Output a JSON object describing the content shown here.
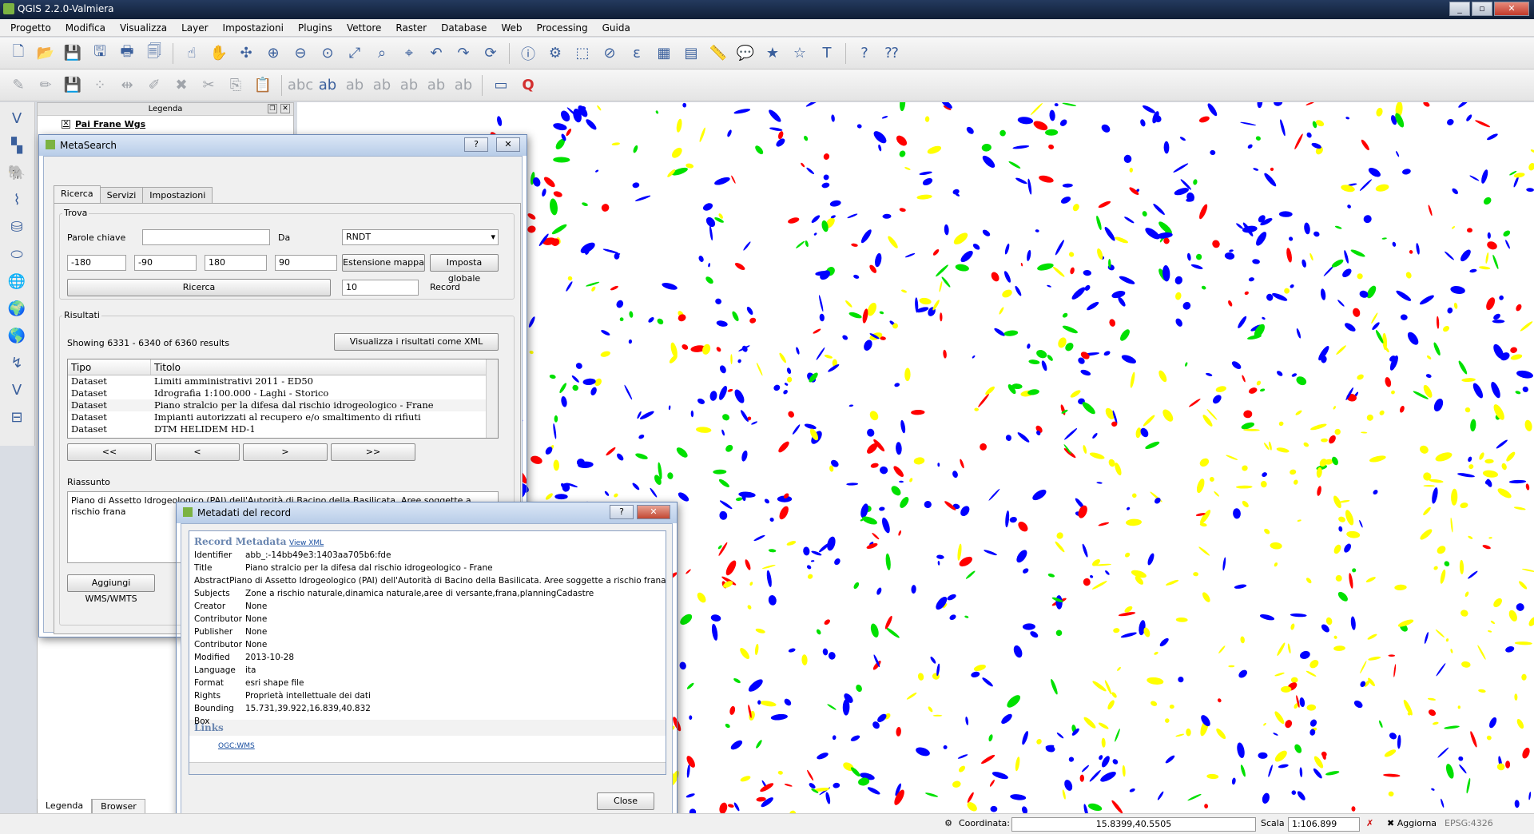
{
  "window": {
    "title": "QGIS 2.2.0-Valmiera",
    "buttons": [
      "_",
      "▫",
      "✕"
    ]
  },
  "menu": [
    "Progetto",
    "Modifica",
    "Visualizza",
    "Layer",
    "Impostazioni",
    "Plugins",
    "Vettore",
    "Raster",
    "Database",
    "Web",
    "Processing",
    "Guida"
  ],
  "legend": {
    "header": "Legenda",
    "layer_name": "Pai Frane Wgs",
    "tabs": [
      "Legenda",
      "Browser"
    ]
  },
  "metasearch": {
    "title": "MetaSearch",
    "tabs": [
      "Ricerca",
      "Servizi",
      "Impostazioni"
    ],
    "find_group": "Trova",
    "keywords_label": "Parole chiave",
    "keywords_value": "",
    "from_label": "Da",
    "service": "RNDT",
    "bbox": [
      "-180",
      "-90",
      "180",
      "90"
    ],
    "map_extent_button": "Estensione mappa",
    "global_button": "Imposta globale",
    "search_button": "Ricerca",
    "record_count": "10",
    "record_label": "Record",
    "results_group": "Risultati",
    "showing": "Showing 6331 - 6340 of 6360 results",
    "xml_button": "Visualizza i risultati come XML",
    "columns": [
      "Tipo",
      "Titolo"
    ],
    "rows": [
      {
        "type": "Dataset",
        "title": "Limiti amministrativi 2011 - ED50"
      },
      {
        "type": "Dataset",
        "title": "Idrografia 1:100.000 - Laghi - Storico"
      },
      {
        "type": "Dataset",
        "title": "Piano stralcio per la difesa dal rischio idrogeologico - Frane"
      },
      {
        "type": "Dataset",
        "title": "Impianti autorizzati al recupero e/o smaltimento di rifiuti"
      },
      {
        "type": "Dataset",
        "title": "DTM HELIDEM HD-1"
      }
    ],
    "nav": [
      "<<",
      "<",
      ">",
      ">>"
    ],
    "abstract_label": "Riassunto",
    "abstract": "Piano di Assetto Idrogeologico (PAI) dell'Autorità di Bacino della Basilicata. Aree soggette a rischio frana",
    "add_button": "Aggiungi WMS/WMTS"
  },
  "metadata": {
    "title": "Metadati del record",
    "heading": "Record Metadata",
    "view_xml": "View XML",
    "fields": [
      {
        "k": "Identifier",
        "v": "abb_:-14bb49e3:1403aa705b6:fde"
      },
      {
        "k": "Title",
        "v": "Piano stralcio per la difesa dal rischio idrogeologico - Frane"
      },
      {
        "k": "Abstract",
        "v": "Piano di Assetto Idrogeologico (PAI) dell'Autorità di Bacino della Basilicata. Aree soggette a rischio frana"
      },
      {
        "k": "Subjects",
        "v": "Zone a rischio naturale,dinamica naturale,aree di versante,frana,planningCadastre"
      },
      {
        "k": "Creator",
        "v": "None"
      },
      {
        "k": "Contributor",
        "v": "None"
      },
      {
        "k": "Publisher",
        "v": "None"
      },
      {
        "k": "Contributor",
        "v": "None"
      },
      {
        "k": "Modified",
        "v": "2013-10-28"
      },
      {
        "k": "Language",
        "v": "ita"
      },
      {
        "k": "Format",
        "v": "esri shape file"
      },
      {
        "k": "Rights",
        "v": "Proprietà intellettuale dei dati"
      },
      {
        "k": "Bounding Box",
        "v": "15.731,39.922,16.839,40.832"
      }
    ],
    "links_heading": "Links",
    "link": "OGC:WMS",
    "close_button": "Close"
  },
  "status": {
    "coord_label": "Coordinata:",
    "coord_value": "15.8399,40.5505",
    "scale_label": "Scala",
    "scale_value": "1:106.899",
    "refresh_label": "Aggiorna",
    "crs": "EPSG:4326"
  },
  "map_colors": {
    "red": "#ff0000",
    "blue": "#0000ff",
    "green": "#00e000",
    "yellow": "#ffff00"
  }
}
